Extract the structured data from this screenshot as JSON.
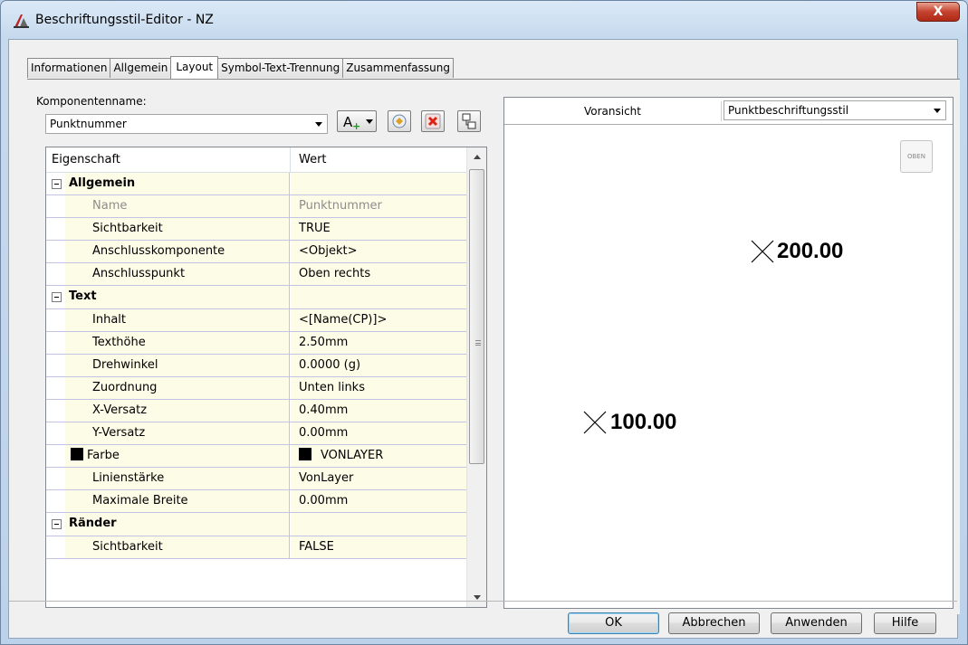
{
  "window": {
    "title": "Beschriftungsstil-Editor - NZ",
    "close_label": "X"
  },
  "tabs": [
    {
      "label": "Informationen",
      "active": false
    },
    {
      "label": "Allgemein",
      "active": false
    },
    {
      "label": "Layout",
      "active": true
    },
    {
      "label": "Symbol-Text-Trennung",
      "active": false
    },
    {
      "label": "Zusammenfassung",
      "active": false
    }
  ],
  "component": {
    "label": "Komponentenname:",
    "value": "Punktnummer"
  },
  "grid": {
    "col_property": "Eigenschaft",
    "col_value": "Wert",
    "rows": [
      {
        "name": "Allgemein",
        "value": "",
        "type": "category"
      },
      {
        "name": "Name",
        "value": "Punktnummer",
        "type": "disabled"
      },
      {
        "name": "Sichtbarkeit",
        "value": "TRUE",
        "type": "normal"
      },
      {
        "name": "Anschlusskomponente",
        "value": "<Objekt>",
        "type": "normal"
      },
      {
        "name": "Anschlusspunkt",
        "value": "Oben rechts",
        "type": "normal"
      },
      {
        "name": "Text",
        "value": "",
        "type": "category"
      },
      {
        "name": "Inhalt",
        "value": "<[Name(CP)]>",
        "type": "normal"
      },
      {
        "name": "Texthöhe",
        "value": "2.50mm",
        "type": "normal"
      },
      {
        "name": "Drehwinkel",
        "value": "0.0000 (g)",
        "type": "normal"
      },
      {
        "name": "Zuordnung",
        "value": "Unten links",
        "type": "normal"
      },
      {
        "name": "X-Versatz",
        "value": "0.40mm",
        "type": "normal"
      },
      {
        "name": "Y-Versatz",
        "value": "0.00mm",
        "type": "normal"
      },
      {
        "name": "Farbe",
        "value": "VONLAYER",
        "type": "color"
      },
      {
        "name": "Linienstärke",
        "value": "VonLayer",
        "type": "normal"
      },
      {
        "name": "Maximale Breite",
        "value": "0.00mm",
        "type": "normal"
      },
      {
        "name": "Ränder",
        "value": "",
        "type": "category"
      },
      {
        "name": "Sichtbarkeit",
        "value": "FALSE",
        "type": "normal"
      }
    ]
  },
  "preview": {
    "label": "Voransicht",
    "style_value": "Punktbeschriftungsstil",
    "oben_label": "OBEN",
    "point_labels": [
      "200.00",
      "100.00"
    ]
  },
  "buttons": {
    "ok": "OK",
    "cancel": "Abbrechen",
    "apply": "Anwenden",
    "help": "Hilfe"
  }
}
